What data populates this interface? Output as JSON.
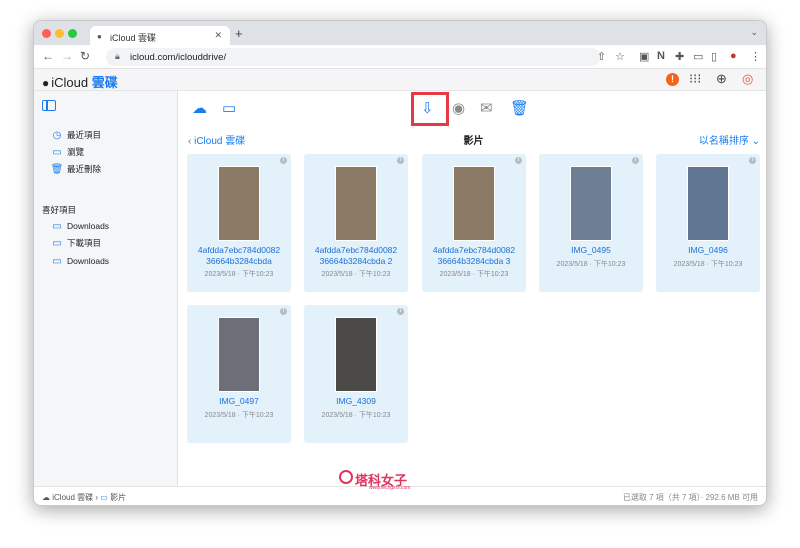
{
  "browser": {
    "tab_title": "iCloud 雲碟",
    "url": "icloud.com/iclouddrive/",
    "new_tab": "+",
    "icons": [
      "back-icon",
      "forward-icon",
      "reload-icon",
      "share-icon",
      "star-icon",
      "camera-icon",
      "extension-icon",
      "puzzle-icon",
      "cast-icon",
      "sidebar-icon",
      "avatar",
      "more-icon"
    ]
  },
  "app": {
    "brand_prefix": "iCloud",
    "brand_drive": "雲碟",
    "alert": "!"
  },
  "sidebar": {
    "items": [
      {
        "label": "最近項目",
        "icon": "clock-icon"
      },
      {
        "label": "瀏覽",
        "icon": "folder-icon"
      },
      {
        "label": "最近刪除",
        "icon": "trash-icon"
      }
    ],
    "favorites_heading": "喜好項目",
    "favorites": [
      {
        "label": "Downloads",
        "icon": "folder-icon"
      },
      {
        "label": "下載項目",
        "icon": "folder-icon"
      },
      {
        "label": "Downloads",
        "icon": "folder-icon"
      }
    ]
  },
  "toolbar": {
    "icons": [
      "upload-icon",
      "new-folder-icon",
      "download-icon",
      "share-person-icon",
      "mail-icon",
      "trash-icon"
    ]
  },
  "header": {
    "back_label": "iCloud 雲碟",
    "title": "影片",
    "sort_label": "以名稱排序"
  },
  "files": [
    {
      "name_line1": "4afdda7ebc784d0082",
      "name_line2": "36664b3284cbda",
      "date": "2023/5/18 · 下午10:23",
      "bg": "#8b7b66"
    },
    {
      "name_line1": "4afdda7ebc784d0082",
      "name_line2": "36664b3284cbda 2",
      "date": "2023/5/18 · 下午10:23",
      "bg": "#8b7b66"
    },
    {
      "name_line1": "4afdda7ebc784d0082",
      "name_line2": "36664b3284cbda 3",
      "date": "2023/5/18 · 下午10:23",
      "bg": "#8b7b66"
    },
    {
      "name_line1": "IMG_0495",
      "name_line2": "",
      "date": "2023/5/18 · 下午10:23",
      "bg": "#6e7f94"
    },
    {
      "name_line1": "IMG_0496",
      "name_line2": "",
      "date": "2023/5/18 · 下午10:23",
      "bg": "#5f7591"
    },
    {
      "name_line1": "IMG_0497",
      "name_line2": "",
      "date": "2023/5/18 · 下午10:23",
      "bg": "#6d6f78"
    },
    {
      "name_line1": "IMG_4309",
      "name_line2": "",
      "date": "2023/5/18 · 下午10:23",
      "bg": "#4b4a47"
    }
  ],
  "status": {
    "path_root": "iCloud 雲碟",
    "path_folder": "影片",
    "summary": "已選取 7 項（共 7 項）· 292.6 MB 可用"
  },
  "watermark": {
    "brand": "塔科女子",
    "url": "www.techgirls.com"
  },
  "colors": {
    "accent": "#1a7cf0",
    "highlight": "#e63946",
    "card_bg": "#e3f1fb"
  }
}
